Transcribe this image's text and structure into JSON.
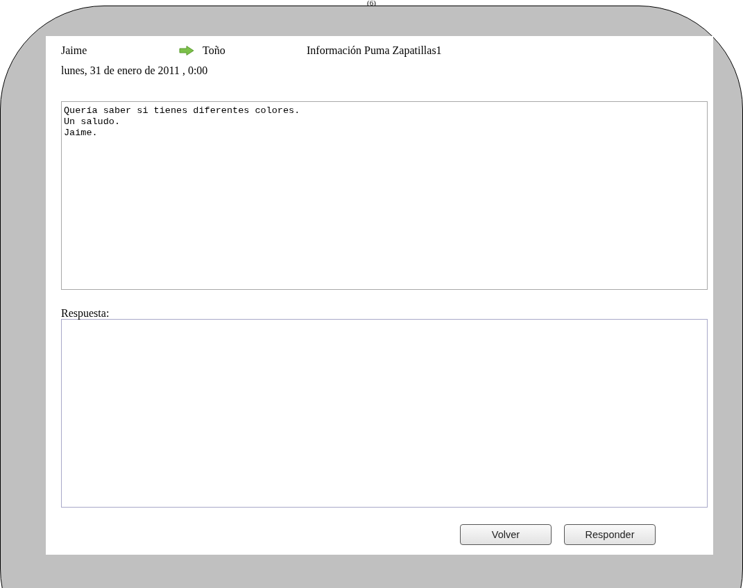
{
  "caption": "(6)",
  "header": {
    "sender": "Jaime",
    "recipient": "Toño",
    "subject": "Información Puma Zapatillas1",
    "date": "lunes, 31 de enero de 2011 , 0:00"
  },
  "message": {
    "value": "Quería saber si tienes diferentes colores.\nUn saludo.\nJaime."
  },
  "reply": {
    "label": "Respuesta:"
  },
  "buttons": [
    "Volver",
    "Responder"
  ]
}
